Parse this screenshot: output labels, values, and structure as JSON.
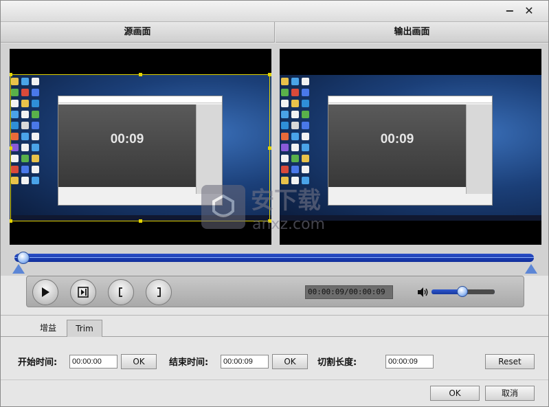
{
  "window": {
    "minimize_glyph": "−",
    "close_glyph": "✕"
  },
  "headers": {
    "source": "源画面",
    "output": "输出画面"
  },
  "preview": {
    "source_time": "00:09",
    "output_time": "00:09"
  },
  "player": {
    "time_display": "00:00:09/00:00:09",
    "volume_level": 0.57,
    "seek_position": 0.0,
    "buttons": [
      "play-icon",
      "next-frame-icon",
      "mark-in-icon",
      "mark-out-icon"
    ]
  },
  "tabs": [
    {
      "label": "增益",
      "active": false
    },
    {
      "label": "Trim",
      "active": true
    }
  ],
  "trim": {
    "start_label": "开始时间:",
    "start_value": "00:00:00",
    "start_ok": "OK",
    "end_label": "结束时间:",
    "end_value": "00:00:09",
    "end_ok": "OK",
    "length_label": "切割长度:",
    "length_value": "00:00:09",
    "reset": "Reset"
  },
  "footer": {
    "ok": "OK",
    "cancel": "取消"
  },
  "watermark": {
    "text": "安下载",
    "sub": "anxz.com"
  }
}
